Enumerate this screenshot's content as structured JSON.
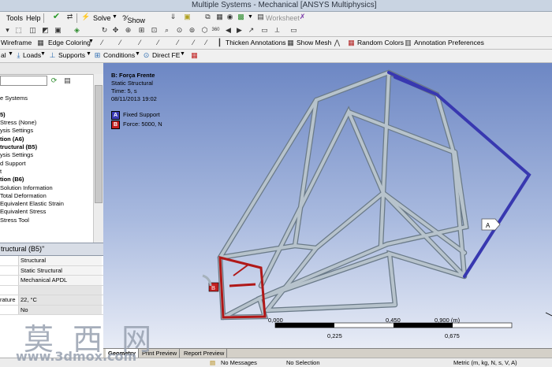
{
  "window": {
    "title": "Multiple Systems - Mechanical [ANSYS Multiphysics]"
  },
  "menu": {
    "items": [
      "Tools",
      "Help"
    ]
  },
  "toolbar1": {
    "solve_label": "Solve",
    "show_errors_label": "Show Errors",
    "worksheet_label": "Worksheet"
  },
  "toolbar2": {
    "wireframe_label": "Wireframe",
    "edge_coloring_label": "Edge Coloring",
    "thicken_annotations_label": "Thicken Annotations",
    "show_mesh_label": "Show Mesh",
    "random_colors_label": "Random Colors",
    "annotation_preferences_label": "Annotation Preferences"
  },
  "toolbar3": {
    "loads_label": "Loads",
    "supports_label": "Supports",
    "conditions_label": "Conditions",
    "direct_fe_label": "Direct FE"
  },
  "tree": {
    "items": [
      {
        "label": "",
        "bold": false
      },
      {
        "label": "e Systems",
        "bold": false
      },
      {
        "label": "",
        "bold": false
      },
      {
        "label": "5)",
        "bold": true
      },
      {
        "label": "Stress (None)",
        "bold": false
      },
      {
        "label": "ysis Settings",
        "bold": false
      },
      {
        "label": "tion (A6)",
        "bold": true
      },
      {
        "label": "tructural (B5)",
        "bold": true
      },
      {
        "label": "ysis Settings",
        "bold": false
      },
      {
        "label": "d Support",
        "bold": false
      },
      {
        "label": "t",
        "bold": false
      },
      {
        "label": "tion (B6)",
        "bold": true
      },
      {
        "label": "Solution Information",
        "bold": false
      },
      {
        "label": "Total Deformation",
        "bold": false
      },
      {
        "label": "Equivalent Elastic Strain",
        "bold": false
      },
      {
        "label": "Equivalent Stress",
        "bold": false
      },
      {
        "label": "Stress Tool",
        "bold": false
      }
    ]
  },
  "details": {
    "header": "tructural (B5)\"",
    "rows": [
      {
        "key": "",
        "value": "Structural"
      },
      {
        "key": "",
        "value": "Static Structural"
      },
      {
        "key": "",
        "value": "Mechanical APDL"
      },
      {
        "key": "",
        "value": ""
      },
      {
        "key": "rature",
        "value": "22, °C"
      },
      {
        "key": "",
        "value": "No"
      }
    ]
  },
  "viewport": {
    "analysis_title": "B: Força Frente",
    "analysis_type": "Static Structural",
    "time": "Time: 5, s",
    "date": "08/11/2013 19:02",
    "legend": [
      {
        "letter": "A",
        "label": "Fixed Support",
        "color": "#3c3cb8"
      },
      {
        "letter": "B",
        "label": "Force: 5000, N",
        "color": "#c42020"
      }
    ],
    "annotation_a": "A",
    "annotation_b": "B",
    "scale": {
      "ticks_top": [
        "0,000",
        "0,450",
        "0,900 (m)"
      ],
      "ticks_bottom": [
        "0,225",
        "0,675"
      ]
    }
  },
  "bottom_tabs": [
    "Geometry",
    "Print Preview",
    "Report Preview"
  ],
  "status": {
    "messages": "No Messages",
    "selection": "No Selection",
    "units": "Metric (m, kg, N, s, V, A)"
  },
  "watermark": {
    "chars": "莫 西 网",
    "url": "www.3dmox.com"
  }
}
